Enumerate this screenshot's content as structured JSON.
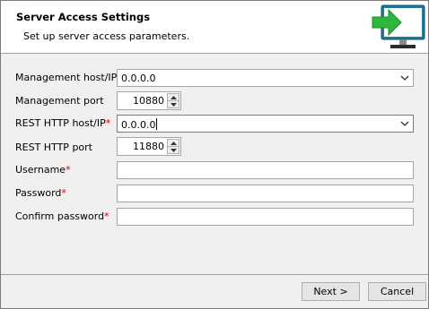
{
  "header": {
    "title": "Server Access Settings",
    "subtitle": "Set up server access parameters.",
    "icon": "monitor-arrow-icon"
  },
  "form": {
    "management_host": {
      "label": "Management host/IP",
      "required": "*",
      "value": "0.0.0.0"
    },
    "management_port": {
      "label": "Management port",
      "value": "10880"
    },
    "rest_host": {
      "label": "REST HTTP host/IP",
      "required": "*",
      "value": "0.0.0.0"
    },
    "rest_port": {
      "label": "REST HTTP port",
      "value": "11880"
    },
    "username": {
      "label": "Username",
      "required": "*",
      "value": ""
    },
    "password": {
      "label": "Password",
      "required": "*",
      "value": ""
    },
    "confirm_password": {
      "label": "Confirm password",
      "required": "*",
      "value": ""
    }
  },
  "buttons": {
    "next": "Next >",
    "cancel": "Cancel"
  },
  "colors": {
    "required": "#d40000",
    "icon_arrow": "#2db83d",
    "icon_screen": "#1e7a9a"
  }
}
